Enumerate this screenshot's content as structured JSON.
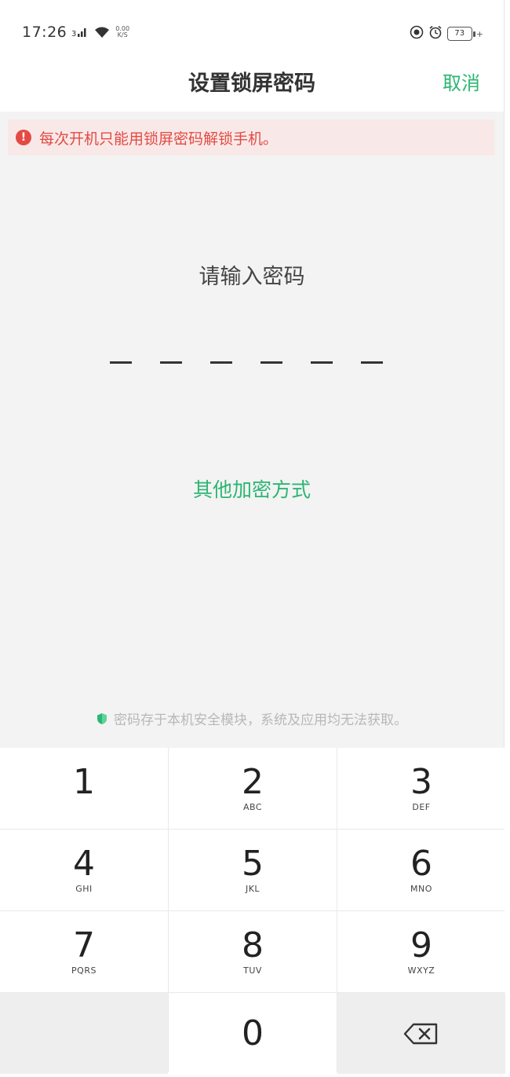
{
  "status_bar": {
    "time": "17:26",
    "net_speed_value": "0.00",
    "net_speed_unit": "K/S",
    "battery_level": "73",
    "icons": [
      "signal-icon",
      "wifi-icon",
      "location-icon",
      "alarm-icon",
      "battery-icon",
      "charging-icon"
    ]
  },
  "header": {
    "title": "设置锁屏密码",
    "cancel_label": "取消"
  },
  "warning": {
    "text": "每次开机只能用锁屏密码解锁手机。"
  },
  "main": {
    "prompt": "请输入密码",
    "pin_length": 6,
    "other_methods_label": "其他加密方式",
    "security_note": "密码存于本机安全模块，系统及应用均无法获取。"
  },
  "keypad": {
    "keys": [
      {
        "digit": "1",
        "letters": ""
      },
      {
        "digit": "2",
        "letters": "ABC"
      },
      {
        "digit": "3",
        "letters": "DEF"
      },
      {
        "digit": "4",
        "letters": "GHI"
      },
      {
        "digit": "5",
        "letters": "JKL"
      },
      {
        "digit": "6",
        "letters": "MNO"
      },
      {
        "digit": "7",
        "letters": "PQRS"
      },
      {
        "digit": "8",
        "letters": "TUV"
      },
      {
        "digit": "9",
        "letters": "WXYZ"
      }
    ],
    "zero": "0",
    "backspace_icon": "backspace-icon"
  },
  "colors": {
    "accent": "#2bb673",
    "warning": "#e44a43",
    "warning_bg": "#f8e9e8",
    "content_bg": "#f3f3f3"
  }
}
